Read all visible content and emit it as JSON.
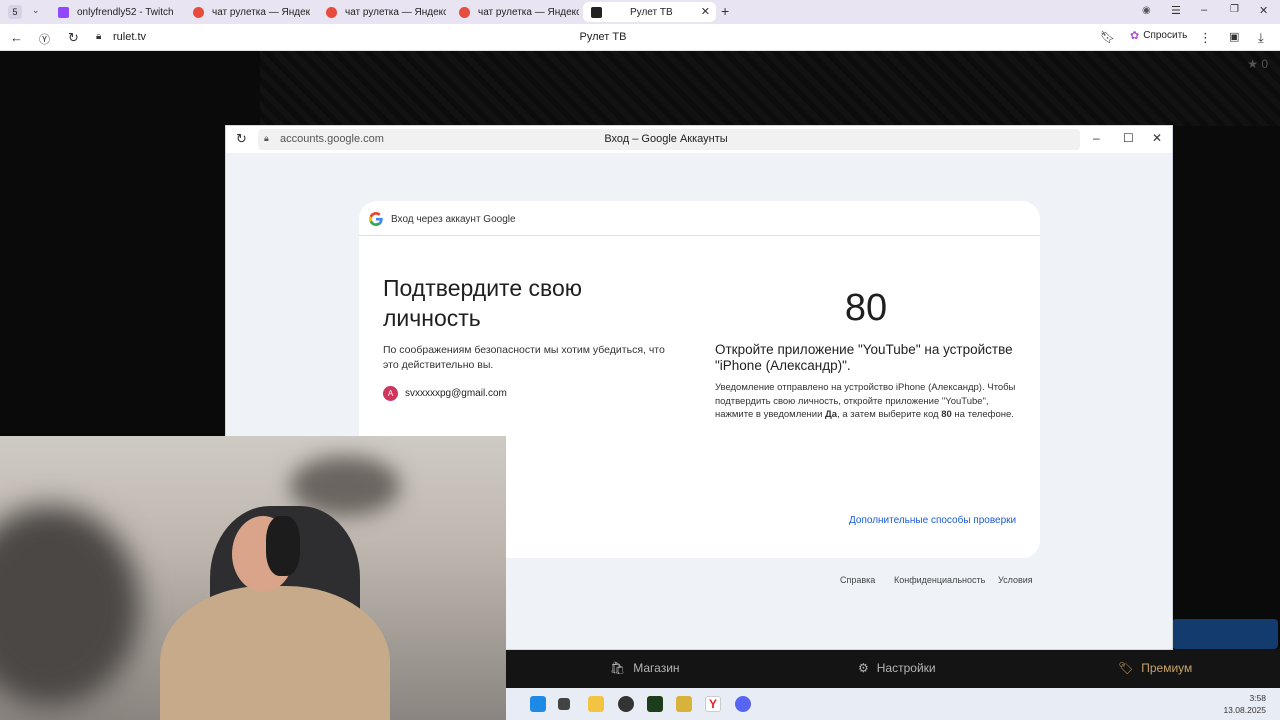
{
  "browser": {
    "tab_counter": "5",
    "tabs": [
      {
        "label": "onlyfrendly52 - Twitch",
        "color": "#9146ff"
      },
      {
        "label": "чат рулетка — Яндекс: на",
        "color": "#e74c3c"
      },
      {
        "label": "чат рулетка — Яндекс: на",
        "color": "#e74c3c"
      },
      {
        "label": "чат рулетка — Яндекс: на",
        "color": "#e74c3c"
      },
      {
        "label": "Рулет ТВ",
        "color": "#222222"
      }
    ],
    "url": "rulet.tv",
    "page_title": "Рулет ТВ",
    "ask_label": "Спросить"
  },
  "page": {
    "star_count": "0",
    "bottom": {
      "shop": "Магазин",
      "settings": "Настройки",
      "premium": "Премиум"
    }
  },
  "popup": {
    "url": "accounts.google.com",
    "title": "Вход – Google Аккаунты",
    "signin_label": "Вход через аккаунт Google",
    "heading": "Подтвердите свою личность",
    "description": "По соображениям безопасности мы хотим убедиться, что это действительно вы.",
    "avatar_letter": "A",
    "email": "svxxxxxpg@gmail.com",
    "code": "80",
    "open_app": "Откройте приложение \"YouTube\" на устройстве \"iPhone (Александр)\".",
    "notice_pre": "Уведомление отправлено на устройство iPhone (Александр). Чтобы подтвердить свою личность, откройте приложение \"YouTube\", нажмите в уведомлении ",
    "notice_yes": "Да",
    "notice_mid": ", а затем выберите код ",
    "notice_code": "80",
    "notice_post": " на телефоне.",
    "more_ways": "Дополнительные способы проверки",
    "footer": {
      "help": "Справка",
      "privacy": "Конфиденциальность",
      "terms": "Условия"
    }
  },
  "taskbar": {
    "time": "3:58",
    "date": "13.08.2025"
  }
}
